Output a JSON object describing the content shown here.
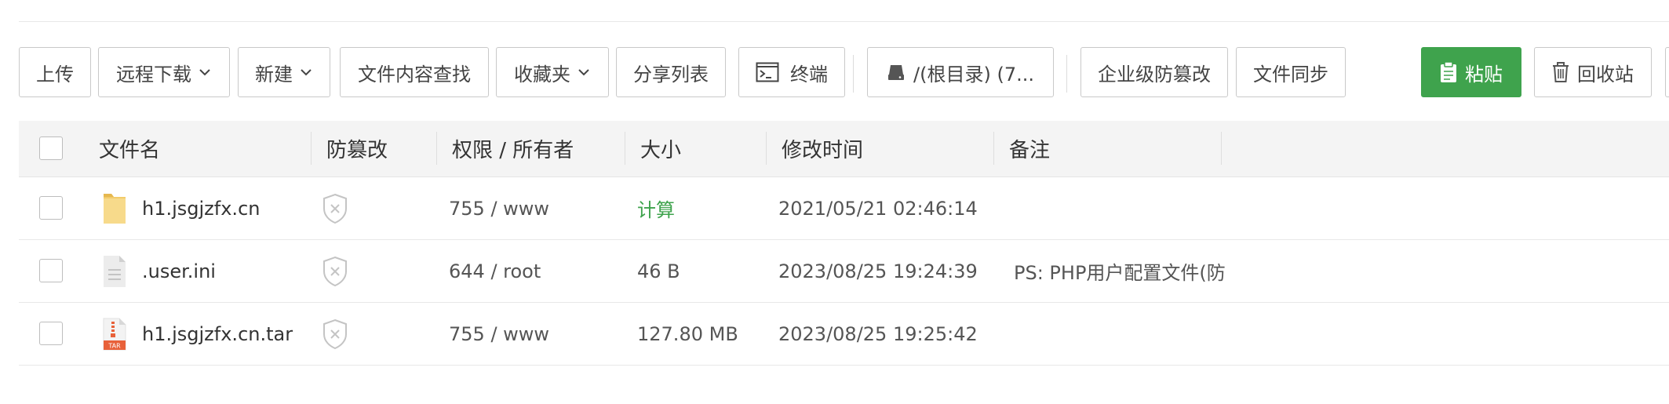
{
  "toolbar": {
    "upload": "上传",
    "remote_download": "远程下载",
    "new": "新建",
    "content_search": "文件内容查找",
    "favorites": "收藏夹",
    "share_list": "分享列表",
    "terminal": "终端",
    "path": "/(根目录) (7...",
    "enterprise_tamper": "企业级防篡改",
    "file_sync": "文件同步",
    "paste": "粘贴",
    "recycle_bin": "回收站"
  },
  "table": {
    "headers": {
      "name": "文件名",
      "tamper": "防篡改",
      "perm_owner": "权限 / 所有者",
      "size": "大小",
      "mtime": "修改时间",
      "note": "备注"
    },
    "rows": [
      {
        "name": "h1.jsgjzfx.cn",
        "icon": "folder-icon",
        "perm": "755 / www",
        "size": "计算",
        "mtime": "2021/05/21 02:46:14",
        "note": ""
      },
      {
        "name": ".user.ini",
        "icon": "file-icon",
        "perm": "644 / root",
        "size": "46 B",
        "mtime": "2023/08/25 19:24:39",
        "note": "PS: PHP用户配置文件(防"
      },
      {
        "name": "h1.jsgjzfx.cn.tar",
        "icon": "tar-archive-icon",
        "perm": "755 / www",
        "size": "127.80 MB",
        "mtime": "2023/08/25 19:25:42",
        "note": ""
      }
    ]
  },
  "colors": {
    "accent_green": "#3fa34d",
    "header_bg": "#f4f4f4",
    "border": "#c9c9c9"
  }
}
